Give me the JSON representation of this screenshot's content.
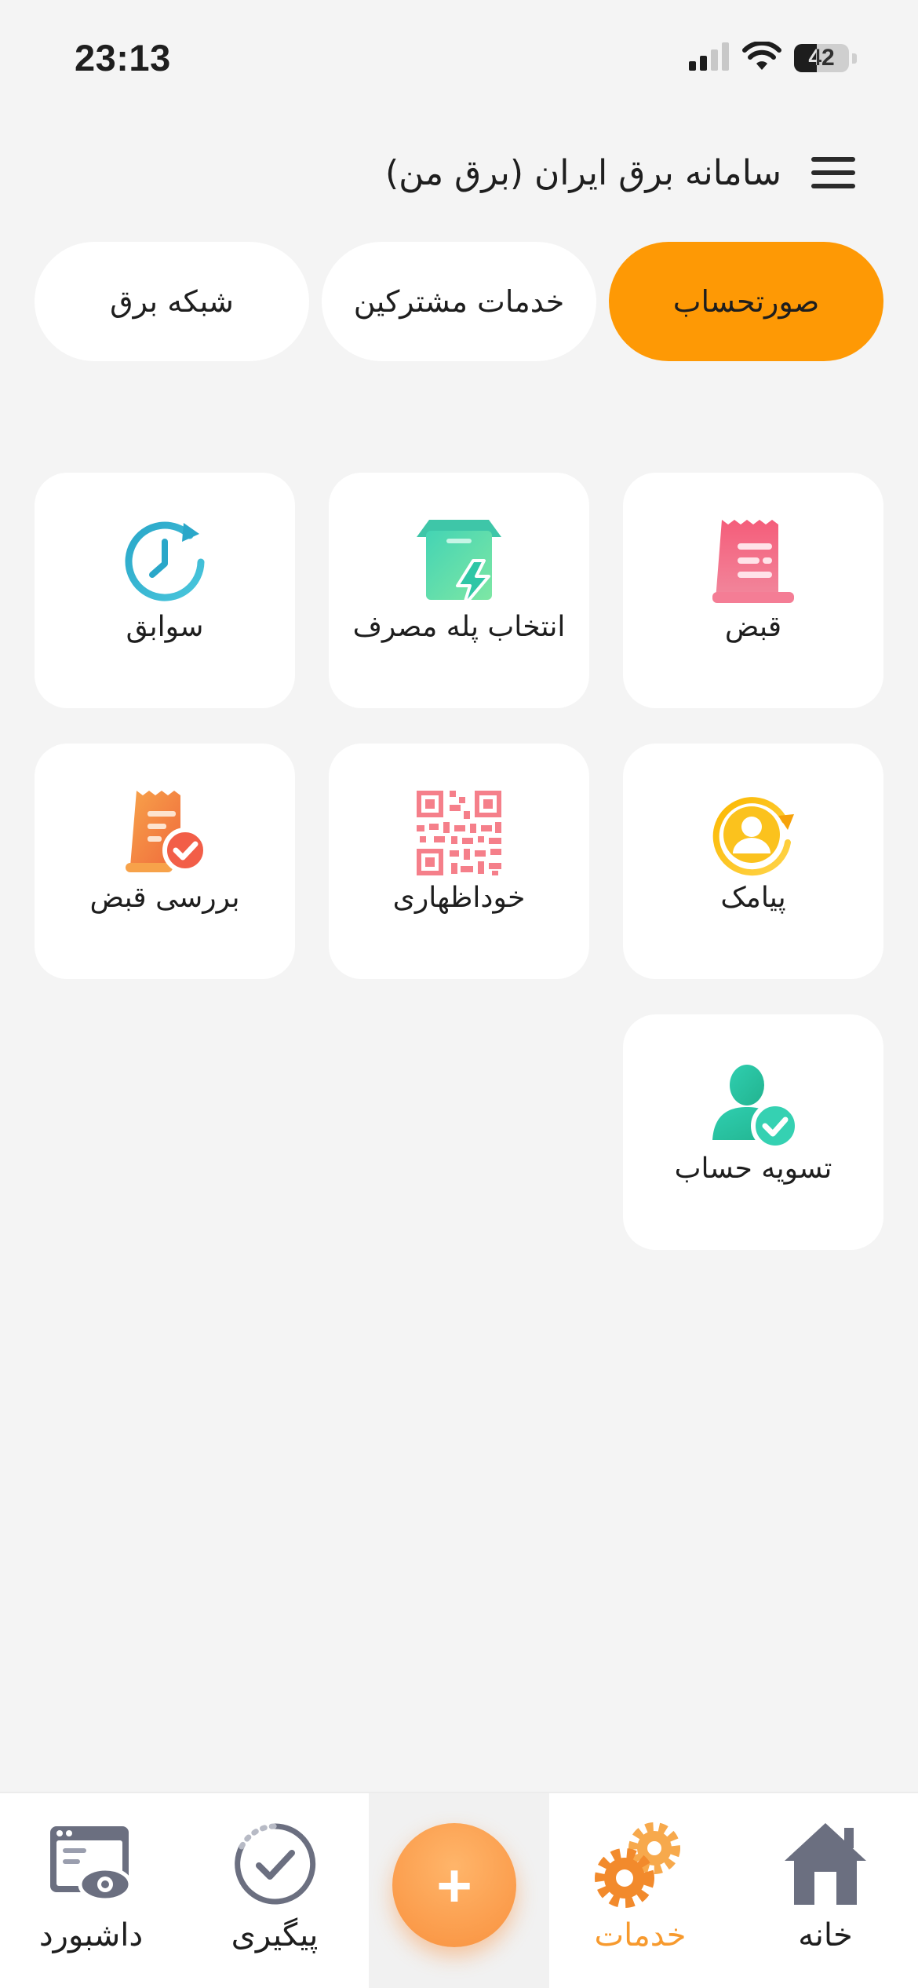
{
  "status_bar": {
    "time": "23:13",
    "battery": "42",
    "battery_level_percent": 42,
    "icons": [
      "cellular-signal-icon",
      "wifi-icon",
      "battery-icon"
    ]
  },
  "header": {
    "title": "سامانه برق ایران (برق من)",
    "menu_icon": "hamburger-menu-icon"
  },
  "tabs": [
    {
      "label": "صورتحساب",
      "active": true
    },
    {
      "label": "خدمات مشترکین",
      "active": false
    },
    {
      "label": "شبکه برق",
      "active": false
    }
  ],
  "services": [
    {
      "label": "قبض",
      "icon": "bill-receipt-icon"
    },
    {
      "label": "انتخاب پله مصرف",
      "icon": "power-box-icon"
    },
    {
      "label": "سوابق",
      "icon": "history-clock-icon"
    },
    {
      "label": "پیامک",
      "icon": "sms-user-refresh-icon"
    },
    {
      "label": "خوداظهاری",
      "icon": "qr-code-icon"
    },
    {
      "label": "بررسی قبض",
      "icon": "bill-check-icon"
    },
    {
      "label": "تسویه حساب",
      "icon": "user-check-icon"
    }
  ],
  "bottom_nav": {
    "items": [
      {
        "label": "خانه",
        "icon": "home-icon",
        "active": false
      },
      {
        "label": "خدمات",
        "icon": "gears-icon",
        "active": true
      },
      {
        "label": "پیگیری",
        "icon": "tracking-check-icon",
        "active": false
      },
      {
        "label": "داشبورد",
        "icon": "dashboard-eye-icon",
        "active": false
      }
    ],
    "fab_label": "+"
  },
  "colors": {
    "accent": "#fe9905",
    "background": "#f4f4f4",
    "card": "#ffffff",
    "nav_inactive": "#6b6f80",
    "nav_active": "#f79a2e"
  }
}
